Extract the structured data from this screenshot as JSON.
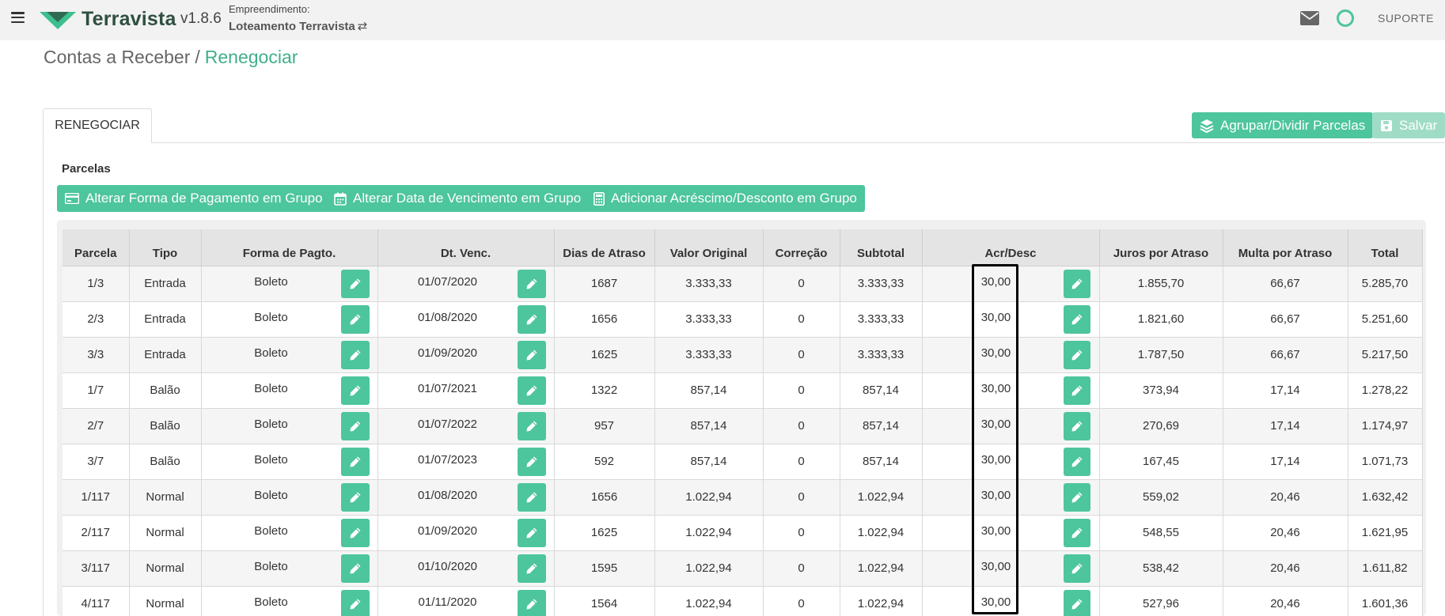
{
  "header": {
    "brand": "Terravista",
    "version": "v1.8.6",
    "empreendimento_label": "Empreendimento:",
    "empreendimento_name": "Loteamento Terravista",
    "swap_glyph": "⇄",
    "support": "SUPORTE",
    "colors": {
      "accent": "#4dc59d",
      "header_bg": "#f2f2f2",
      "brand_text": "#2f4f3f"
    }
  },
  "breadcrumb": {
    "parent": "Contas a Receber",
    "separator": "/",
    "current": "Renegociar"
  },
  "tabs": [
    {
      "label": "RENEGOCIAR"
    }
  ],
  "actions": {
    "group_split": "Agrupar/Dividir Parcelas",
    "save": "Salvar"
  },
  "section": {
    "title": "Parcelas",
    "group_buttons": {
      "payment_method": "Alterar Forma de Pagamento em Grupo",
      "due_date": "Alterar Data de Vencimento em Grupo",
      "surcharge_discount": "Adicionar Acréscimo/Desconto em Grupo"
    }
  },
  "table": {
    "columns": [
      "Parcela",
      "Tipo",
      "Forma de Pagto.",
      "Dt. Venc.",
      "Dias de Atraso",
      "Valor Original",
      "Correção",
      "Subtotal",
      "Acr/Desc",
      "Juros por Atraso",
      "Multa por Atraso",
      "Total"
    ],
    "rows": [
      [
        "1/3",
        "Entrada",
        "Boleto",
        "01/07/2020",
        "1687",
        "3.333,33",
        "0",
        "3.333,33",
        "30,00",
        "1.855,70",
        "66,67",
        "5.285,70"
      ],
      [
        "2/3",
        "Entrada",
        "Boleto",
        "01/08/2020",
        "1656",
        "3.333,33",
        "0",
        "3.333,33",
        "30,00",
        "1.821,60",
        "66,67",
        "5.251,60"
      ],
      [
        "3/3",
        "Entrada",
        "Boleto",
        "01/09/2020",
        "1625",
        "3.333,33",
        "0",
        "3.333,33",
        "30,00",
        "1.787,50",
        "66,67",
        "5.217,50"
      ],
      [
        "1/7",
        "Balão",
        "Boleto",
        "01/07/2021",
        "1322",
        "857,14",
        "0",
        "857,14",
        "30,00",
        "373,94",
        "17,14",
        "1.278,22"
      ],
      [
        "2/7",
        "Balão",
        "Boleto",
        "01/07/2022",
        "957",
        "857,14",
        "0",
        "857,14",
        "30,00",
        "270,69",
        "17,14",
        "1.174,97"
      ],
      [
        "3/7",
        "Balão",
        "Boleto",
        "01/07/2023",
        "592",
        "857,14",
        "0",
        "857,14",
        "30,00",
        "167,45",
        "17,14",
        "1.071,73"
      ],
      [
        "1/117",
        "Normal",
        "Boleto",
        "01/08/2020",
        "1656",
        "1.022,94",
        "0",
        "1.022,94",
        "30,00",
        "559,02",
        "20,46",
        "1.632,42"
      ],
      [
        "2/117",
        "Normal",
        "Boleto",
        "01/09/2020",
        "1625",
        "1.022,94",
        "0",
        "1.022,94",
        "30,00",
        "548,55",
        "20,46",
        "1.621,95"
      ],
      [
        "3/117",
        "Normal",
        "Boleto",
        "01/10/2020",
        "1595",
        "1.022,94",
        "0",
        "1.022,94",
        "30,00",
        "538,42",
        "20,46",
        "1.611,82"
      ],
      [
        "4/117",
        "Normal",
        "Boleto",
        "01/11/2020",
        "1564",
        "1.022,94",
        "0",
        "1.022,94",
        "30,00",
        "527,96",
        "20,46",
        "1.601,36"
      ]
    ]
  }
}
